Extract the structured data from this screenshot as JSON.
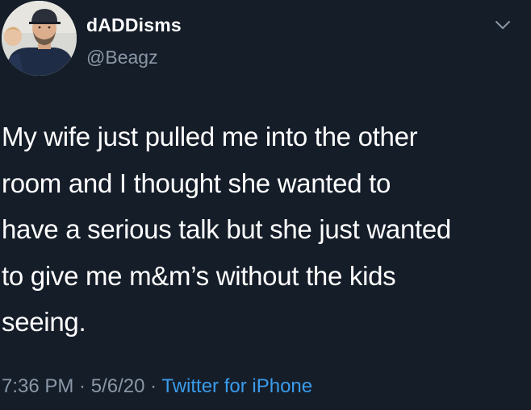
{
  "tweet": {
    "author": {
      "display_name": "dADDisms",
      "handle": "@Beagz"
    },
    "text_lines": [
      "My wife just pulled me into the other",
      "room and I thought she wanted to",
      "have a serious talk but she just wanted",
      "to give me m&m’s without the kids",
      "seeing."
    ],
    "time": "7:36 PM",
    "separator": " · ",
    "date": "5/6/20",
    "source": "Twitter for iPhone"
  },
  "icons": {
    "menu": "chevron-down-icon",
    "avatar": "profile-photo"
  },
  "colors": {
    "background": "#151d29",
    "primary_text": "#ffffff",
    "secondary_text": "#8a97a6",
    "link": "#3a9cec"
  }
}
